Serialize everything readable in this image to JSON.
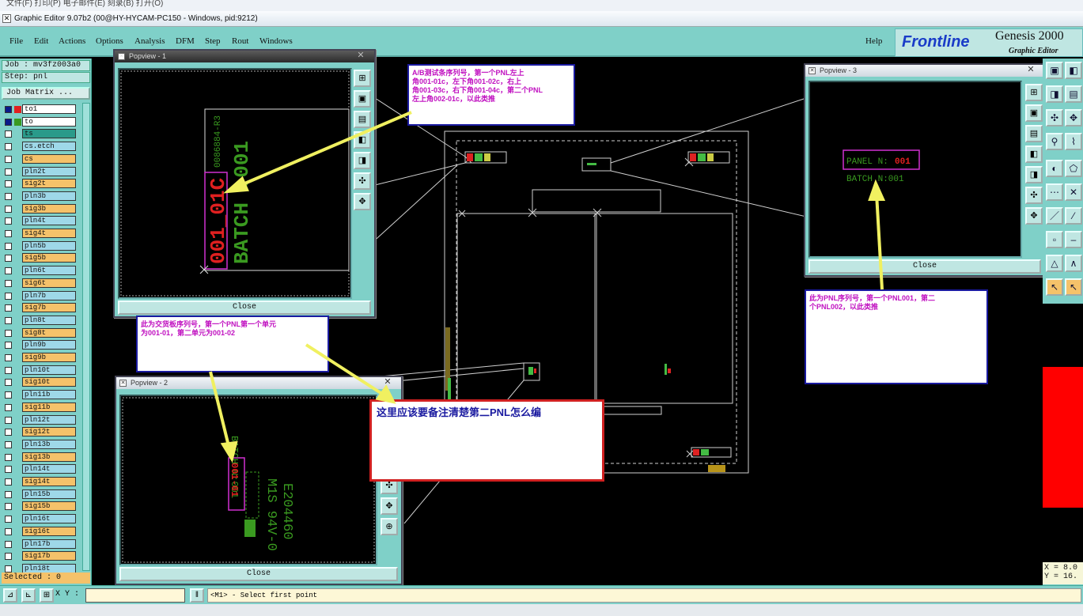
{
  "top_strip": "文件(F)  打印(P)  电子邮件(E)  刻录(B)  打开(O)",
  "window": {
    "title": "Graphic Editor 9.07b2 (00@HY-HYCAM-PC150 - Windows, pid:9212)"
  },
  "menu": [
    "File",
    "Edit",
    "Actions",
    "Options",
    "Analysis",
    "DFM",
    "Step",
    "Rout",
    "Windows"
  ],
  "help_label": "Help",
  "logo": {
    "brand": "Frontline",
    "product": "Genesis 2000",
    "subtitle": "Graphic Editor"
  },
  "info": {
    "job": "Job : mv3fz003a0",
    "step": "Step: pnl",
    "job_matrix": "Job Matrix ..."
  },
  "layers": [
    {
      "name": "to1",
      "color": "#ffffff"
    },
    {
      "name": "to",
      "color": "#ffffff"
    },
    {
      "name": "ts",
      "color": "#2a9a8a"
    },
    {
      "name": "cs.etch",
      "color": "#9ed8e8"
    },
    {
      "name": "cs",
      "color": "#f5c26a"
    },
    {
      "name": "pln2t",
      "color": "#9ed8e8"
    },
    {
      "name": "sig2t",
      "color": "#f5c26a"
    },
    {
      "name": "pln3b",
      "color": "#9ed8e8"
    },
    {
      "name": "sig3b",
      "color": "#f5c26a"
    },
    {
      "name": "pln4t",
      "color": "#9ed8e8"
    },
    {
      "name": "sig4t",
      "color": "#f5c26a"
    },
    {
      "name": "pln5b",
      "color": "#9ed8e8"
    },
    {
      "name": "sig5b",
      "color": "#f5c26a"
    },
    {
      "name": "pln6t",
      "color": "#9ed8e8"
    },
    {
      "name": "sig6t",
      "color": "#f5c26a"
    },
    {
      "name": "pln7b",
      "color": "#9ed8e8"
    },
    {
      "name": "sig7b",
      "color": "#f5c26a"
    },
    {
      "name": "pln8t",
      "color": "#9ed8e8"
    },
    {
      "name": "sig8t",
      "color": "#f5c26a"
    },
    {
      "name": "pln9b",
      "color": "#9ed8e8"
    },
    {
      "name": "sig9b",
      "color": "#f5c26a"
    },
    {
      "name": "pln10t",
      "color": "#9ed8e8"
    },
    {
      "name": "sig10t",
      "color": "#f5c26a"
    },
    {
      "name": "pln11b",
      "color": "#9ed8e8"
    },
    {
      "name": "sig11b",
      "color": "#f5c26a"
    },
    {
      "name": "pln12t",
      "color": "#9ed8e8"
    },
    {
      "name": "sig12t",
      "color": "#f5c26a"
    },
    {
      "name": "pln13b",
      "color": "#9ed8e8"
    },
    {
      "name": "sig13b",
      "color": "#f5c26a"
    },
    {
      "name": "pln14t",
      "color": "#9ed8e8"
    },
    {
      "name": "sig14t",
      "color": "#f5c26a"
    },
    {
      "name": "pln15b",
      "color": "#9ed8e8"
    },
    {
      "name": "sig15b",
      "color": "#f5c26a"
    },
    {
      "name": "pln16t",
      "color": "#9ed8e8"
    },
    {
      "name": "sig16t",
      "color": "#f5c26a"
    },
    {
      "name": "pln17b",
      "color": "#9ed8e8"
    },
    {
      "name": "sig17b",
      "color": "#f5c26a"
    },
    {
      "name": "pln18t",
      "color": "#9ed8e8"
    }
  ],
  "selected": "Selected : 0",
  "bottom": {
    "xy_label": "X Y :",
    "status": "<M1> - Select first point"
  },
  "coords": {
    "x": "X = 8.0",
    "y": "Y = 16."
  },
  "popups": {
    "p1": {
      "title": "Popview - 1",
      "close": "Close",
      "text_serial": "001_01C",
      "text_batch": "BATCH :001",
      "text_code": "0086884-R3"
    },
    "p2": {
      "title": "Popview - 2",
      "close": "Close",
      "text_batch": "BATCH N:001",
      "text_unit": "001-01",
      "text_e": "E204460",
      "text_m": "M1S 94V-0"
    },
    "p3": {
      "title": "Popview - 3",
      "close": "Close",
      "text_panel_label": "PANEL N:",
      "text_panel_num": "001",
      "text_batch": "BATCH N:001"
    }
  },
  "notes": {
    "n1": [
      "A/B测试条序列号，第一个PNL左上",
      "角001-01c，左下角001-02c，右上",
      "角001-03c，右下角001-04c，第二个PNL",
      "左上角002-01c，以此类推"
    ],
    "n2": [
      "此为交货板序列号，第一个PNL第一个单元",
      "为001-01，第二单元为001-02"
    ],
    "n3": [
      "此为PNL序列号，第一个PNL001，第二",
      "个PNL002，以此类推"
    ],
    "n4": "这里应该要备注清楚第二PNL怎么编"
  }
}
